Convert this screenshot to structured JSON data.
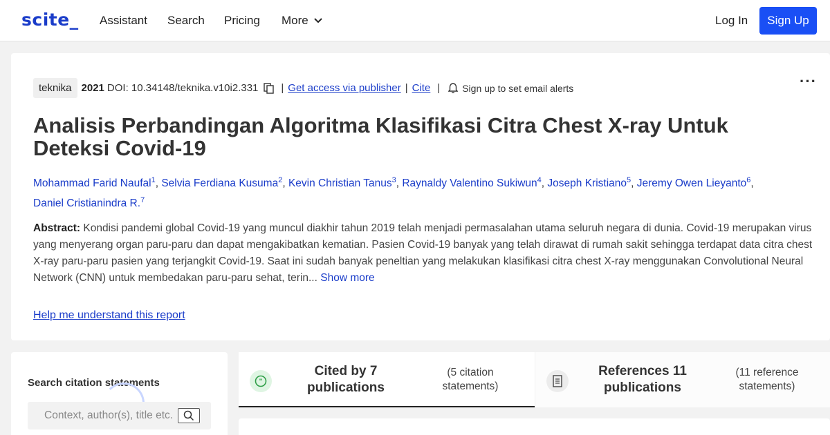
{
  "nav": {
    "logo": "scite_",
    "links": [
      "Assistant",
      "Search",
      "Pricing"
    ],
    "more": "More",
    "login": "Log In",
    "signup": "Sign Up"
  },
  "paper": {
    "journal": "teknika",
    "year": "2021",
    "doi": "DOI: 10.34148/teknika.v10i2.331",
    "access_link": "Get access via publisher",
    "cite_link": "Cite",
    "alerts": "Sign up to set email alerts",
    "title": "Analisis Perbandingan Algoritma Klasifikasi Citra Chest X-ray Untuk Deteksi Covid-19",
    "authors": [
      {
        "name": "Mohammad Farid Naufal",
        "sup": "1"
      },
      {
        "name": "Selvia Ferdiana Kusuma",
        "sup": "2"
      },
      {
        "name": "Kevin Christian Tanus",
        "sup": "3"
      },
      {
        "name": "Raynaldy Valentino Sukiwun",
        "sup": "4"
      },
      {
        "name": "Joseph Kristiano",
        "sup": "5"
      },
      {
        "name": "Jeremy Owen Lieyanto",
        "sup": "6"
      },
      {
        "name": "Daniel Cristianindra R.",
        "sup": "7"
      }
    ],
    "abstract_label": "Abstract:",
    "abstract": "Kondisi pandemi global Covid-19 yang muncul diakhir tahun 2019 telah menjadi permasalahan utama seluruh negara di dunia. Covid-19 merupakan virus yang menyerang organ paru-paru dan dapat mengakibatkan kematian. Pasien Covid-19 banyak yang telah dirawat di rumah sakit sehingga terdapat data citra chest X-ray paru-paru pasien yang terjangkit Covid-19. Saat ini sudah banyak peneltian yang melakukan klasifikasi citra chest X-ray menggunakan Convolutional Neural Network (CNN) untuk membedakan paru-paru sehat, terin...",
    "show_more": "Show more",
    "help_link": "Help me understand this report"
  },
  "citations": {
    "search_title": "Search citation statements",
    "search_placeholder": "Context, author(s), title etc.",
    "tab_cited": {
      "main": "Cited by 7 publications",
      "sub": "(5 citation statements)"
    },
    "tab_refs": {
      "main": "References 11 publications",
      "sub": "(11 reference statements)"
    }
  },
  "colors": {
    "brand": "#1a3cc9",
    "button": "#1a4ff5",
    "cited_icon": "#2e9e47"
  }
}
